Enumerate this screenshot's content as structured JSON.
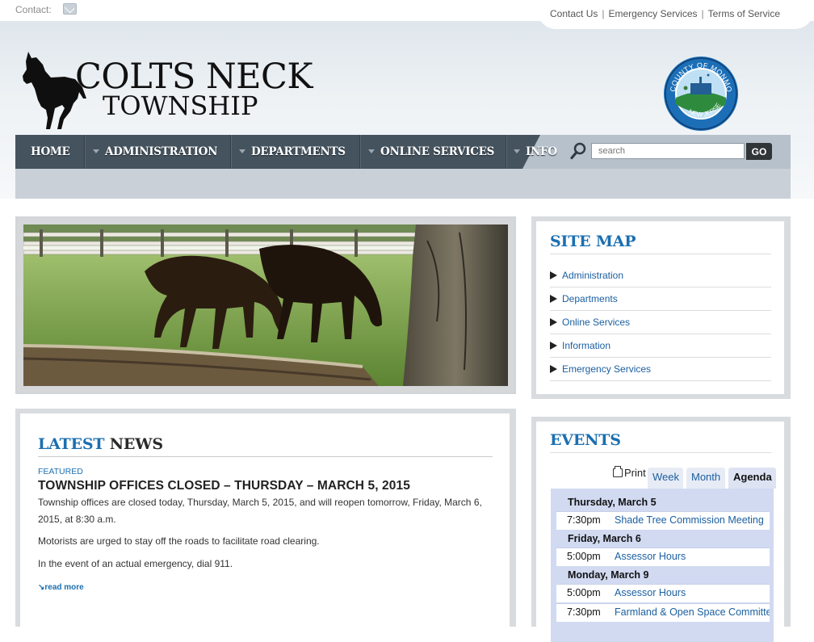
{
  "top": {
    "contact_label": "Contact:",
    "links": [
      "Contact Us",
      "Emergency Services",
      "Terms of Service"
    ]
  },
  "header": {
    "logo_line1": "COLTS NECK",
    "logo_line2": "TOWNSHIP",
    "seal_text_top": "COUNTY OF MONMOUTH",
    "seal_text_bottom": "NEW JERSEY"
  },
  "nav": {
    "items": [
      "HOME",
      "ADMINISTRATION",
      "DEPARTMENTS",
      "ONLINE SERVICES",
      "INFO"
    ],
    "search_placeholder": "search",
    "go_label": "GO"
  },
  "news": {
    "title_highlight": "LATEST",
    "title_rest": "NEWS",
    "tag": "FEATURED",
    "headline": "TOWNSHIP OFFICES CLOSED – THURSDAY – MARCH 5, 2015",
    "paragraphs": [
      "Township offices are closed today, Thursday, March 5, 2015, and will reopen tomorrow, Friday, March 6, 2015, at 8:30 a.m.",
      "Motorists are urged to stay off the roads to facilitate road clearing.",
      "In the event of an actual emergency, dial 911."
    ],
    "read_more": "read more"
  },
  "sitemap": {
    "title": "SITE MAP",
    "items": [
      "Administration",
      "Departments",
      "Online Services",
      "Information",
      "Emergency Services"
    ]
  },
  "events": {
    "title": "EVENTS",
    "print_label": "Print",
    "tabs": [
      "Week",
      "Month",
      "Agenda"
    ],
    "active_tab": "Agenda",
    "days": [
      {
        "date": "Thursday, March 5",
        "events": [
          {
            "time": "7:30pm",
            "name": "Shade Tree Commission Meeting"
          }
        ]
      },
      {
        "date": "Friday, March 6",
        "events": [
          {
            "time": "5:00pm",
            "name": "Assessor Hours"
          }
        ]
      },
      {
        "date": "Monday, March 9",
        "events": [
          {
            "time": "5:00pm",
            "name": "Assessor Hours"
          },
          {
            "time": "7:30pm",
            "name": "Farmland & Open Space Committee"
          }
        ]
      }
    ]
  },
  "colors": {
    "accent_blue": "#1b6fb0",
    "nav_dark": "#45535e",
    "nav_light": "#b7c1cb"
  }
}
